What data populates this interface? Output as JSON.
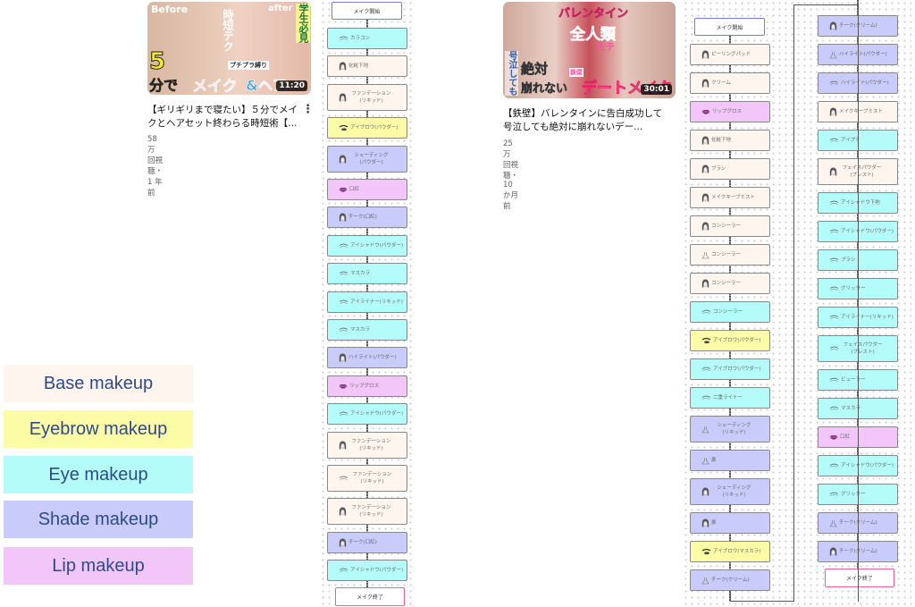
{
  "colors": {
    "base": "#fdf5ee",
    "eyebrow": "#fcfca6",
    "eye": "#b4fcfa",
    "shade": "#c9cbfa",
    "lip": "#f3c6f9"
  },
  "videos": [
    {
      "thumb_text": [
        "Before",
        "after",
        "時短テク",
        "学生必見",
        "5",
        "分で",
        "メイク",
        "&ヘア",
        "プチプラ縛り"
      ],
      "duration": "11:20",
      "title": "【ギリギリまで寝たい】５分でメイクとヘアセット終わらる時短術【...",
      "meta": "58万 回視聴・1 年前"
    },
    {
      "thumb_text": [
        "バレンタイン",
        "全人類",
        "モテ",
        "号泣しても",
        "絶対",
        "崩れない",
        "鉄壁",
        "デートメイク"
      ],
      "duration": "30:01",
      "title": "【鉄壁】バレンタインに告白成功して号泣しても絶対に崩れないデー...",
      "meta": "25万 回視聴・10 か月前"
    }
  ],
  "legend": [
    {
      "label": "Base makeup",
      "category": "base"
    },
    {
      "label": "Eyebrow makeup",
      "category": "eyebrow"
    },
    {
      "label": "Eye makeup",
      "category": "eye"
    },
    {
      "label": "Shade makeup",
      "category": "shade"
    },
    {
      "label": "Lip makeup",
      "category": "lip"
    }
  ],
  "flow_start": "メイク開始",
  "flow_end": "メイク終了",
  "flows": [
    [
      {
        "label": "カラコン",
        "category": "eye",
        "icon": "eye"
      },
      {
        "label": "化粧下地",
        "category": "base",
        "icon": "face"
      },
      {
        "label": "ファンデーション\n(リキッド)",
        "category": "base",
        "icon": "face"
      },
      {
        "label": "アイブロウ(パウダー)",
        "category": "eyebrow",
        "icon": "brow"
      },
      {
        "label": "シェーディング\n(パウダー)",
        "category": "shade",
        "icon": "face"
      },
      {
        "label": "口紅",
        "category": "lip",
        "icon": "lip"
      },
      {
        "label": "チーク(口紅)",
        "category": "shade",
        "icon": "face"
      },
      {
        "label": "アイシャドウ(パウダー)",
        "category": "eye",
        "icon": "eye"
      },
      {
        "label": "マスカラ",
        "category": "eye",
        "icon": "eye"
      },
      {
        "label": "アイライナー(リキッド)",
        "category": "eye",
        "icon": "eye"
      },
      {
        "label": "マスカラ",
        "category": "eye",
        "icon": "eye"
      },
      {
        "label": "ハイライト(パウダー)",
        "category": "shade",
        "icon": "face"
      },
      {
        "label": "リップグロス",
        "category": "lip",
        "icon": "lip"
      },
      {
        "label": "アイシャドウ(パウダー)",
        "category": "eye",
        "icon": "eye"
      },
      {
        "label": "ファンデーション\n(リキッド)",
        "category": "base",
        "icon": "face"
      },
      {
        "label": "ファンデーション\n(リキッド)",
        "category": "base",
        "icon": "eye"
      },
      {
        "label": "ファンデーション\n(リキッド)",
        "category": "base",
        "icon": "face"
      },
      {
        "label": "チーク(口紅)",
        "category": "shade",
        "icon": "face"
      },
      {
        "label": "アイシャドウ(パウダー)",
        "category": "eye",
        "icon": "eye"
      }
    ],
    [
      {
        "label": "ピーリングパッド",
        "category": "base",
        "icon": "face"
      },
      {
        "label": "クリーム",
        "category": "base",
        "icon": "face"
      },
      {
        "label": "リップグロス",
        "category": "lip",
        "icon": "lip"
      },
      {
        "label": "化粧下地",
        "category": "base",
        "icon": "face"
      },
      {
        "label": "ブラシ",
        "category": "base",
        "icon": "face"
      },
      {
        "label": "メイクキープミスト",
        "category": "base",
        "icon": "face"
      },
      {
        "label": "コンシーラー",
        "category": "base",
        "icon": "face"
      },
      {
        "label": "コンシーラー",
        "category": "base",
        "icon": "flask"
      },
      {
        "label": "コンシーラー",
        "category": "base",
        "icon": "face"
      },
      {
        "label": "コンシーラー",
        "category": "eye",
        "icon": "eye"
      },
      {
        "label": "アイブロウ(パウダー)",
        "category": "eyebrow",
        "icon": "brow"
      },
      {
        "label": "アイブロウ(パウダー)",
        "category": "eye",
        "icon": "eye"
      },
      {
        "label": "二重ライナー",
        "category": "eye",
        "icon": "eye"
      },
      {
        "label": "シェーディング\n(リキッド)",
        "category": "shade",
        "icon": "flask"
      },
      {
        "label": "鼻",
        "category": "shade",
        "icon": "flask"
      },
      {
        "label": "シェーディング\n(リキッド)",
        "category": "shade",
        "icon": "face"
      },
      {
        "label": "鼻",
        "category": "shade",
        "icon": "face"
      },
      {
        "label": "アイブロウ(マスカラ)",
        "category": "eyebrow",
        "icon": "brow"
      },
      {
        "label": "チーク(クリーム)",
        "category": "shade",
        "icon": "flask"
      }
    ],
    [
      {
        "label": "チーク(クリーム)",
        "category": "shade",
        "icon": "face"
      },
      {
        "label": "ハイライト(パウダー)",
        "category": "shade",
        "icon": "flask"
      },
      {
        "label": "ハイライト(パウダー)",
        "category": "shade",
        "icon": "eye"
      },
      {
        "label": "メイクキープミスト",
        "category": "base",
        "icon": "face"
      },
      {
        "label": "アイプチ",
        "category": "eye",
        "icon": "eye"
      },
      {
        "label": "フェイスパウダー\n(プレスト)",
        "category": "base",
        "icon": "face"
      },
      {
        "label": "アイシャドウ下地",
        "category": "eye",
        "icon": "eye"
      },
      {
        "label": "アイシャドウ(パウダー)",
        "category": "eye",
        "icon": "eye"
      },
      {
        "label": "ブラシ",
        "category": "eye",
        "icon": "eye"
      },
      {
        "label": "グリッター",
        "category": "eye",
        "icon": "eye"
      },
      {
        "label": "アイライナー(リキッド)",
        "category": "eye",
        "icon": "eye"
      },
      {
        "label": "フェイスパウダー\n(プレスト)",
        "category": "eye",
        "icon": "eye"
      },
      {
        "label": "ビューラー",
        "category": "eye",
        "icon": "eye"
      },
      {
        "label": "マスカラ",
        "category": "eye",
        "icon": "eye"
      },
      {
        "label": "口紅",
        "category": "lip",
        "icon": "lip"
      },
      {
        "label": "アイシャドウ(パウダー)",
        "category": "eye",
        "icon": "eye"
      },
      {
        "label": "グリッター",
        "category": "eye",
        "icon": "eye"
      },
      {
        "label": "チーク(クリーム)",
        "category": "shade",
        "icon": "flask"
      },
      {
        "label": "チーク(クリーム)",
        "category": "shade",
        "icon": "face"
      }
    ]
  ]
}
